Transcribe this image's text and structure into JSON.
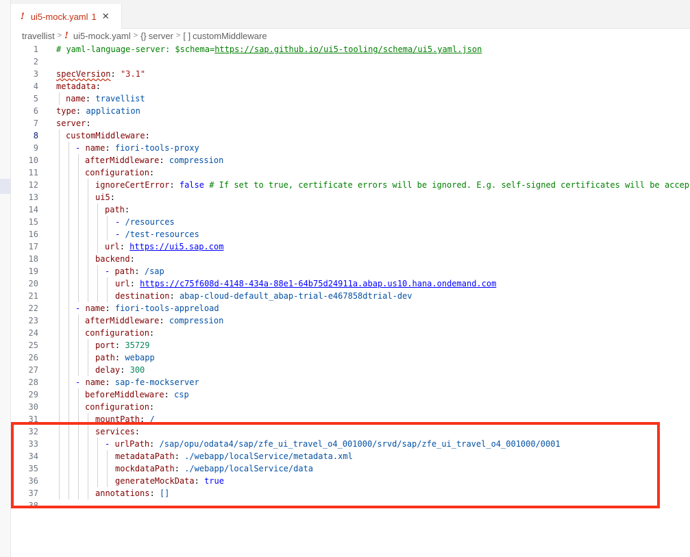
{
  "tab": {
    "filename": "ui5-mock.yaml",
    "problem_count": "1",
    "warning_glyph": "!",
    "close_glyph": "✕"
  },
  "breadcrumb": {
    "folder": "travellist",
    "file": "ui5-mock.yaml",
    "object_symbol": "{}",
    "object": "server",
    "array_symbol": "[ ]",
    "array": "customMiddleware"
  },
  "code_lines": [
    {
      "n": "1"
    },
    {
      "n": "2"
    },
    {
      "n": "3"
    },
    {
      "n": "4"
    },
    {
      "n": "5"
    },
    {
      "n": "6"
    },
    {
      "n": "7"
    },
    {
      "n": "8"
    },
    {
      "n": "9"
    },
    {
      "n": "10"
    },
    {
      "n": "11"
    },
    {
      "n": "12"
    },
    {
      "n": "13"
    },
    {
      "n": "14"
    },
    {
      "n": "15"
    },
    {
      "n": "16"
    },
    {
      "n": "17"
    },
    {
      "n": "18"
    },
    {
      "n": "19"
    },
    {
      "n": "20"
    },
    {
      "n": "21"
    },
    {
      "n": "22"
    },
    {
      "n": "23"
    },
    {
      "n": "24"
    },
    {
      "n": "25"
    },
    {
      "n": "26"
    },
    {
      "n": "27"
    },
    {
      "n": "28"
    },
    {
      "n": "29"
    },
    {
      "n": "30"
    },
    {
      "n": "31"
    },
    {
      "n": "32"
    },
    {
      "n": "33"
    },
    {
      "n": "34"
    },
    {
      "n": "35"
    },
    {
      "n": "36"
    },
    {
      "n": "37"
    },
    {
      "n": "38"
    }
  ],
  "yaml": {
    "l1_comment": "# yaml-language-server: $schema=",
    "l1_url": "https://sap.github.io/ui5-tooling/schema/ui5.yaml.json",
    "l3_key": "specVersion",
    "l3_val": "\"3.1\"",
    "l4_key": "metadata",
    "l5_key": "name",
    "l5_val": "travellist",
    "l6_key": "type",
    "l6_val": "application",
    "l7_key": "server",
    "l8_key": "customMiddleware",
    "l9_key": "name",
    "l9_val": "fiori-tools-proxy",
    "l10_key": "afterMiddleware",
    "l10_val": "compression",
    "l11_key": "configuration",
    "l12_key": "ignoreCertError",
    "l12_val": "false",
    "l12_comment": "# If set to true, certificate errors will be ignored. E.g. self-signed certificates will be accep",
    "l13_key": "ui5",
    "l14_key": "path",
    "l15_val": "/resources",
    "l16_val": "/test-resources",
    "l17_key": "url",
    "l17_val": "https://ui5.sap.com",
    "l18_key": "backend",
    "l19_key": "path",
    "l19_val": "/sap",
    "l20_key": "url",
    "l20_val": "https://c75f608d-4148-434a-88e1-64b75d24911a.abap.us10.hana.ondemand.com",
    "l21_key": "destination",
    "l21_val": "abap-cloud-default_abap-trial-e467858dtrial-dev",
    "l22_key": "name",
    "l22_val": "fiori-tools-appreload",
    "l23_key": "afterMiddleware",
    "l23_val": "compression",
    "l24_key": "configuration",
    "l25_key": "port",
    "l25_val": "35729",
    "l26_key": "path",
    "l26_val": "webapp",
    "l27_key": "delay",
    "l27_val": "300",
    "l28_key": "name",
    "l28_val": "sap-fe-mockserver",
    "l29_key": "beforeMiddleware",
    "l29_val": "csp",
    "l30_key": "configuration",
    "l31_key": "mountPath",
    "l31_val": "/",
    "l32_key": "services",
    "l33_key": "urlPath",
    "l33_val": "/sap/opu/odata4/sap/zfe_ui_travel_o4_001000/srvd/sap/zfe_ui_travel_o4_001000/0001",
    "l34_key": "metadataPath",
    "l34_val": "./webapp/localService/metadata.xml",
    "l35_key": "mockdataPath",
    "l35_val": "./webapp/localService/data",
    "l36_key": "generateMockData",
    "l36_val": "true",
    "l37_key": "annotations",
    "l37_val": "[]"
  },
  "punct": {
    "colon": ":",
    "dash": "-"
  },
  "colors": {
    "highlight_border": "#f8331b",
    "key": "#800000",
    "value": "#0451a5",
    "number": "#098658",
    "comment": "#008000",
    "error": "#c72e0f"
  }
}
